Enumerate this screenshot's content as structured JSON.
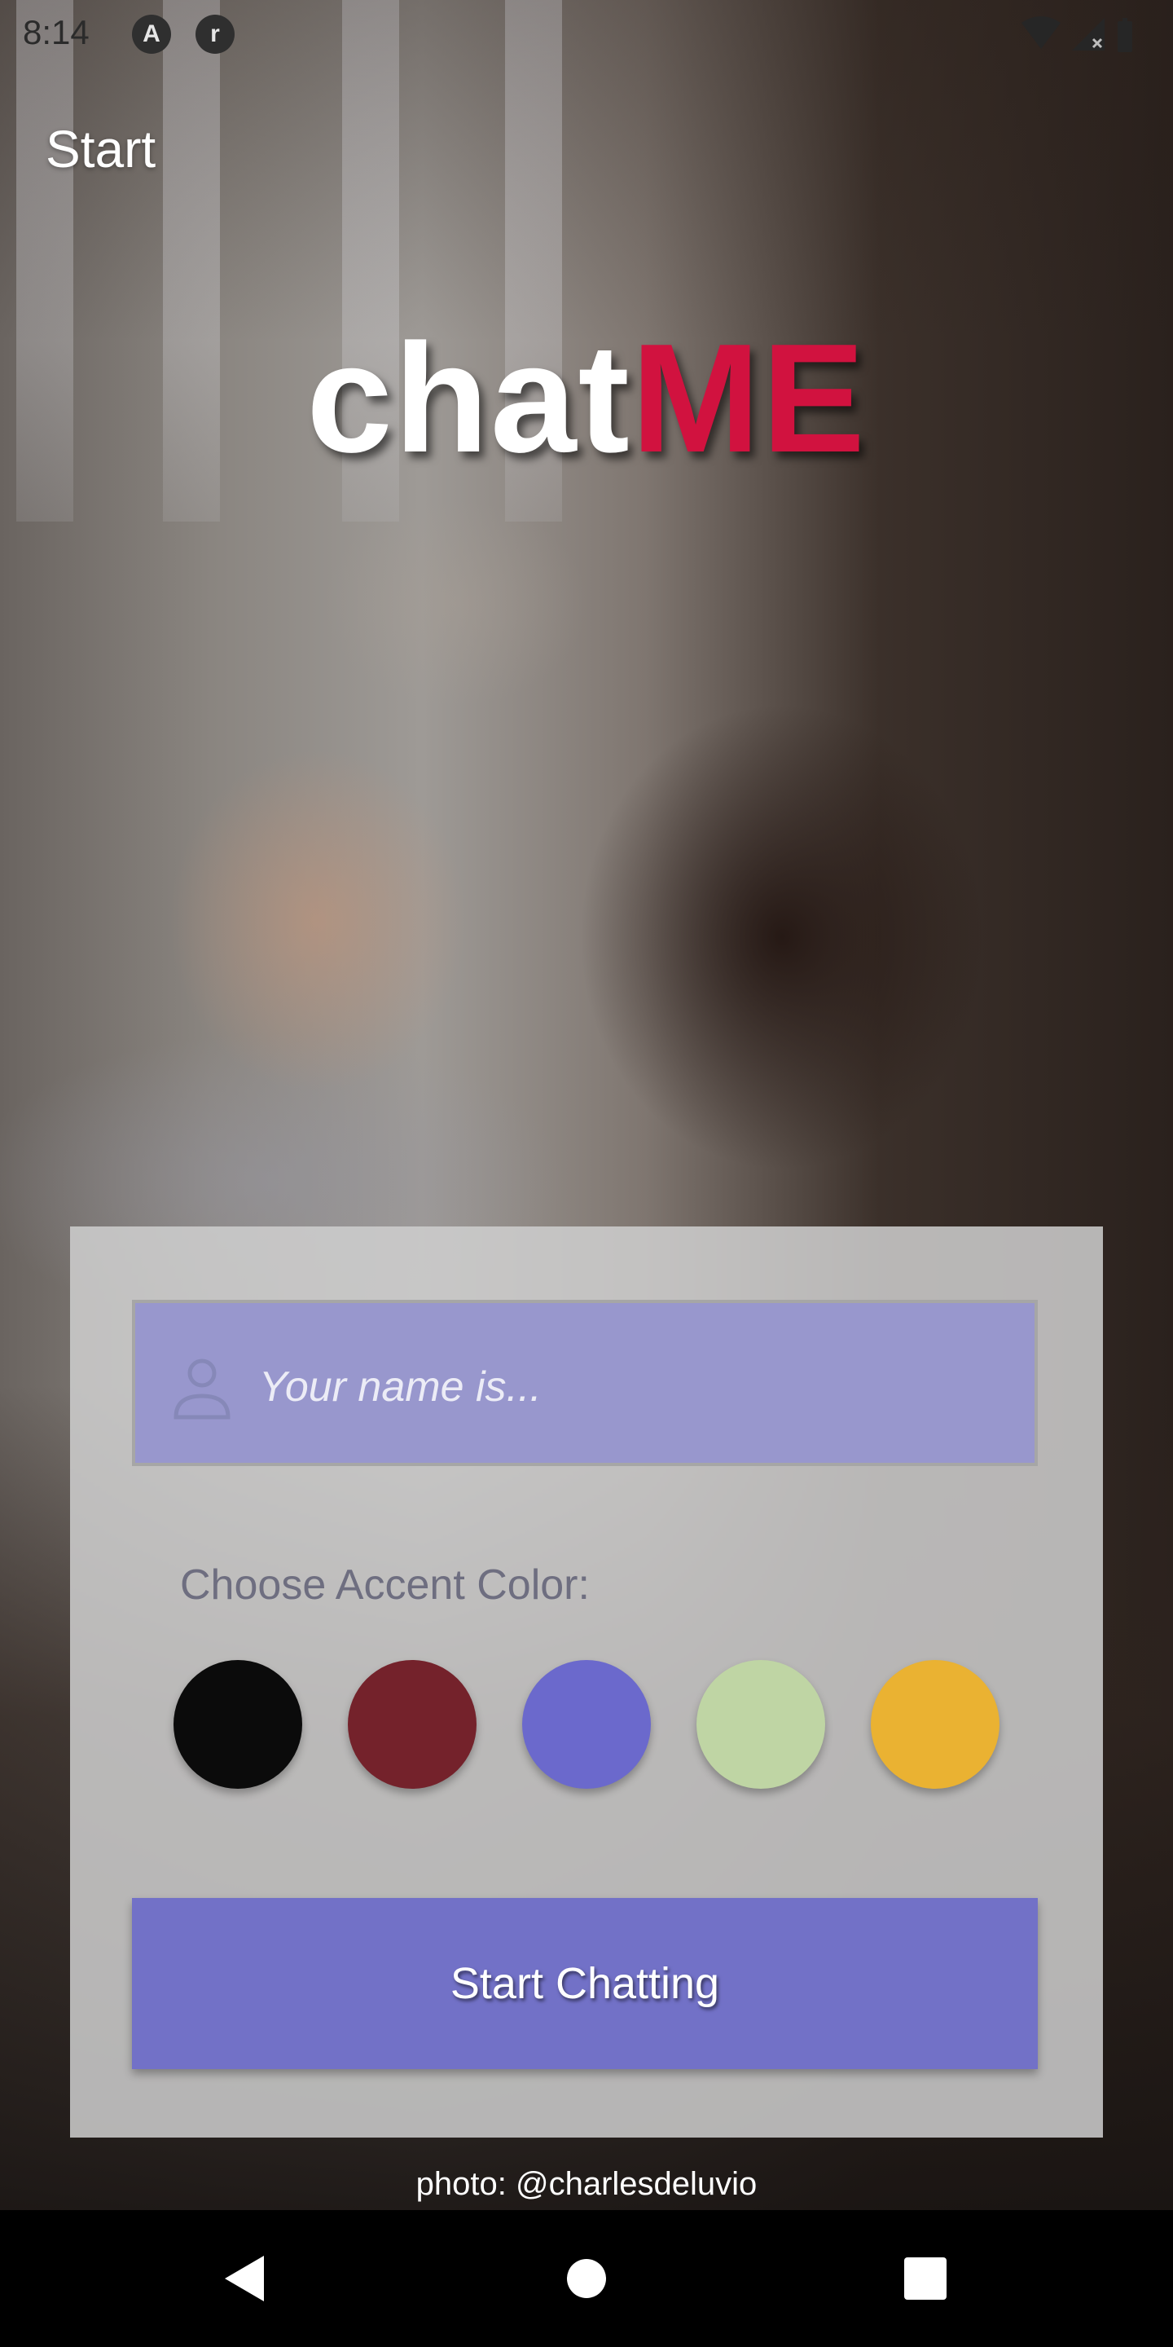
{
  "status_bar": {
    "time": "8:14",
    "app_icons": [
      "A",
      "r"
    ],
    "status_icons": [
      "wifi-icon",
      "cell-signal-icon",
      "battery-icon"
    ]
  },
  "app_bar": {
    "title": "Start"
  },
  "logo": {
    "part1": "chat",
    "part2": "ME",
    "part2_color": "#d1123f"
  },
  "form": {
    "name_placeholder": "Your name is...",
    "accent_label": "Choose Accent Color:",
    "accent_colors": [
      "#0b0b0b",
      "#74222b",
      "#6b69cc",
      "#bfd5a4",
      "#eab232"
    ],
    "start_button_label": "Start Chatting",
    "start_button_color": "#7271c7",
    "name_field_color": "#9897cd"
  },
  "photo_credit": "photo: @charlesdeluvio",
  "nav_bar": {
    "buttons": [
      "back-icon",
      "home-icon",
      "recents-icon"
    ]
  }
}
